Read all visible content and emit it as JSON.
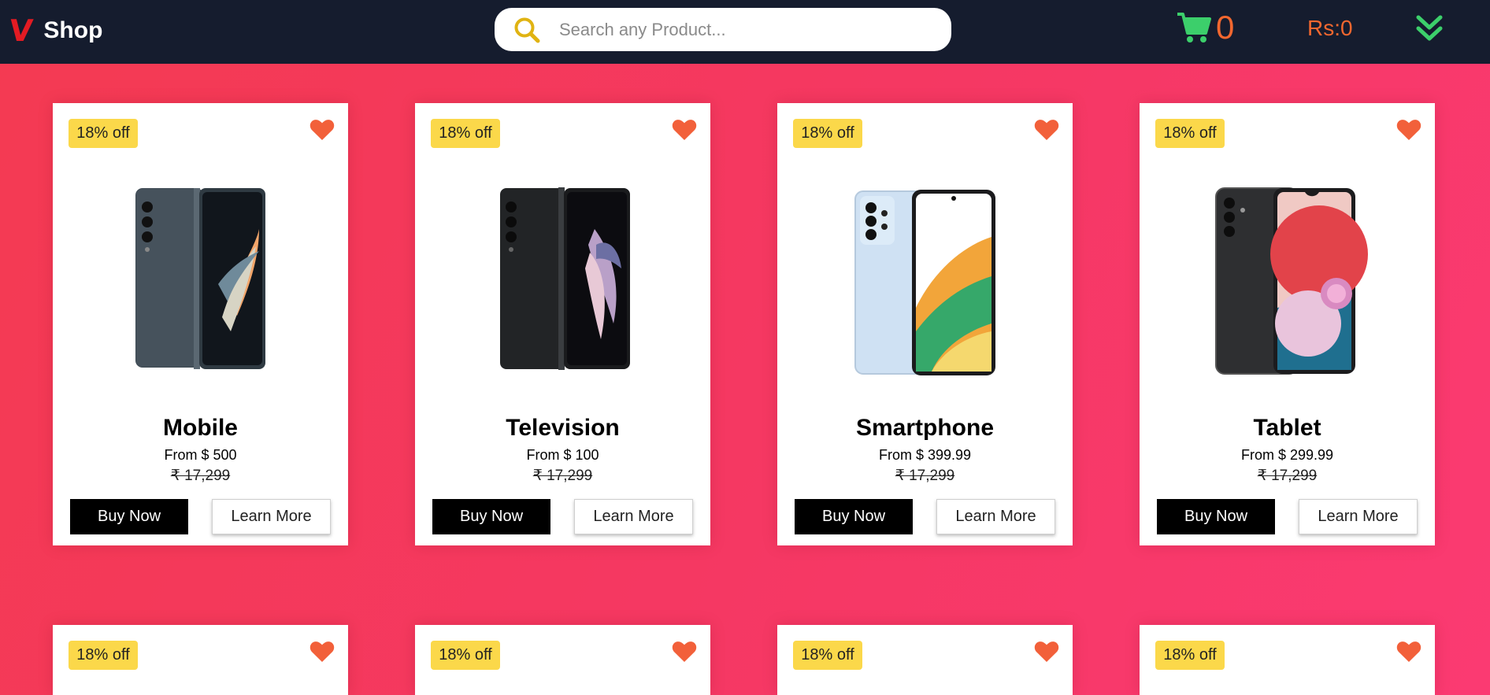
{
  "brand": {
    "mark": "V",
    "name": "Shop"
  },
  "search": {
    "placeholder": "Search any Product...",
    "value": ""
  },
  "cart": {
    "count": "0"
  },
  "balance": "Rs:0",
  "icons": {
    "search": "search-icon",
    "cart": "shopping-cart-icon",
    "menu": "double-chevron-down-icon",
    "wishlist": "heart-icon"
  },
  "colors": {
    "topbar": "#151c2e",
    "accent": "#f2672f",
    "cart_icon": "#3ccf6b",
    "badge": "#fbd84a",
    "heart": "#f2603a",
    "search_icon": "#e0b312",
    "logo_mark": "#e31b23"
  },
  "products": [
    {
      "badge": "18% off",
      "title": "Mobile",
      "price": "From $ 500",
      "old_price": "₹ 17,299",
      "buy_label": "Buy Now",
      "learn_label": "Learn More"
    },
    {
      "badge": "18% off",
      "title": "Television",
      "price": "From $ 100",
      "old_price": "₹ 17,299",
      "buy_label": "Buy Now",
      "learn_label": "Learn More"
    },
    {
      "badge": "18% off",
      "title": "Smartphone",
      "price": "From $ 399.99",
      "old_price": "₹ 17,299",
      "buy_label": "Buy Now",
      "learn_label": "Learn More"
    },
    {
      "badge": "18% off",
      "title": "Tablet",
      "price": "From $ 299.99",
      "old_price": "₹ 17,299",
      "buy_label": "Buy Now",
      "learn_label": "Learn More"
    }
  ],
  "second_row": [
    {
      "badge": "18% off"
    },
    {
      "badge": "18% off"
    },
    {
      "badge": "18% off"
    },
    {
      "badge": "18% off"
    }
  ]
}
